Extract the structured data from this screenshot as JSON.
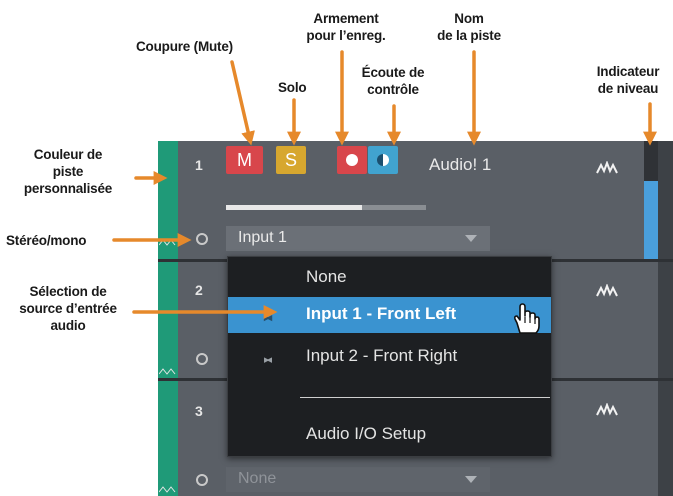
{
  "callouts": {
    "mute": "Coupure (Mute)",
    "solo": "Solo",
    "rec_line1": "Armement",
    "rec_line2": "pour l’enreg.",
    "monitor_line1": "Écoute de",
    "monitor_line2": "contrôle",
    "name_line1": "Nom",
    "name_line2": "de la piste",
    "meter_line1": "Indicateur",
    "meter_line2": "de niveau",
    "color_line1": "Couleur de",
    "color_line2": "piste",
    "color_line3": "personnalisée",
    "stereo": "Stéréo/mono",
    "source_line1": "Sélection de",
    "source_line2": "source d’entrée",
    "source_line3": "audio"
  },
  "tracks": [
    {
      "number": "1",
      "name": "Audio! 1",
      "input": "Input 1",
      "fader_level": 0.68
    },
    {
      "number": "2"
    },
    {
      "number": "3",
      "input": "None"
    }
  ],
  "buttons": {
    "mute": "M",
    "solo": "S"
  },
  "dropdown": {
    "items": [
      {
        "label": "None"
      },
      {
        "label": "Input 1 - Front Left",
        "selected": true
      },
      {
        "label": "Input 2 - Front Right"
      },
      {
        "label": "Audio I/O Setup"
      }
    ]
  },
  "colors": {
    "accent_arrow": "#e6892b",
    "track_color": "#1f9a78",
    "selection": "#3a93d0"
  }
}
